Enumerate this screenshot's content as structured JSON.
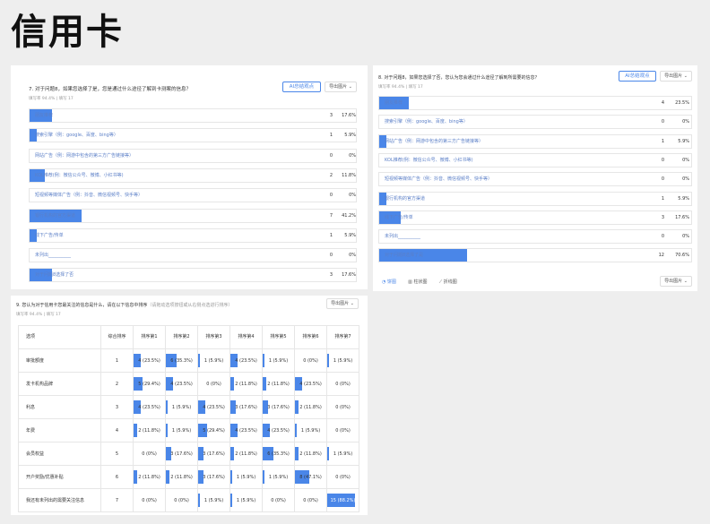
{
  "page_title": "信用卡",
  "q7": {
    "title": "7. 对于问题8，如果您选择了是，您是通过什么途径了解到卡测案的信息？",
    "meta": "填写率 94.4% | 填写 17",
    "ai_label": "AI总结观点",
    "export_label": "导出图片 ⌄",
    "rows": [
      {
        "label": "朋友推荐",
        "count": "3",
        "pct": "17.6%",
        "frac": 0.176
      },
      {
        "label": "搜索引擎（例：google、百度、bing等）",
        "count": "1",
        "pct": "5.9%",
        "frac": 0.059
      },
      {
        "label": "网站广告（例：网游中包含的第三方广告链接等）",
        "count": "0",
        "pct": "0%",
        "frac": 0
      },
      {
        "label": "KOL推荐(例：微信公众号、微博、小红书等)",
        "count": "2",
        "pct": "11.8%",
        "frac": 0.118
      },
      {
        "label": "短视频等媒体广告（例：抖音、微信视频号、快手等）",
        "count": "0",
        "pct": "0%",
        "frac": 0
      },
      {
        "label": "银行机构的官方渠道",
        "count": "7",
        "pct": "41.2%",
        "frac": 0.412
      },
      {
        "label": "线下广告/传单",
        "count": "1",
        "pct": "5.9%",
        "frac": 0.059
      },
      {
        "label": "未列出__________",
        "count": "0",
        "pct": "0%",
        "frac": 0
      },
      {
        "label": "对于问题8选择了否",
        "count": "3",
        "pct": "17.6%",
        "frac": 0.176
      }
    ]
  },
  "q8": {
    "title": "8. 对于问题8，如果您选择了否，您认为您会通过什么途径了解到所需要的信息？",
    "meta": "填写率 94.4% | 填写 17",
    "ai_label": "AI总结观点",
    "export_label": "导出图片 ⌄",
    "rows": [
      {
        "label": "朋友推荐",
        "count": "4",
        "pct": "23.5%",
        "frac": 0.235
      },
      {
        "label": "搜索引擎（例：google、百度、bing等）",
        "count": "0",
        "pct": "0%",
        "frac": 0
      },
      {
        "label": "网站广告（例：网游中包含的第三方广告链接等）",
        "count": "1",
        "pct": "5.9%",
        "frac": 0.059
      },
      {
        "label": "KOL推荐(例：微信公众号、微博、小红书等)",
        "count": "0",
        "pct": "0%",
        "frac": 0
      },
      {
        "label": "短视频等媒体广告（例：抖音、微信视频号、快手等）",
        "count": "0",
        "pct": "0%",
        "frac": 0
      },
      {
        "label": "银行机构的官方渠道",
        "count": "1",
        "pct": "5.9%",
        "frac": 0.059
      },
      {
        "label": "线下广告/传单",
        "count": "3",
        "pct": "17.6%",
        "frac": 0.176
      },
      {
        "label": "未列出__________",
        "count": "0",
        "pct": "0%",
        "frac": 0
      },
      {
        "label": "对于问题8选择了是",
        "count": "12",
        "pct": "70.6%",
        "frac": 0.706
      }
    ],
    "views": [
      "饼图",
      "柱状图",
      "折线图"
    ],
    "export_bottom_label": "导出图片 ⌄"
  },
  "q9": {
    "title": "9. 您认为对于信用卡您最关注的信息是什么，请在以下信息中排序",
    "subtitle": "（请拖动选项按钮或从右侧点选进行排序）",
    "meta": "填写率 94.4% | 填写 17",
    "export_label": "导出图片 ⌄",
    "headers": [
      "选项",
      "综合排序",
      "排序第1",
      "排序第2",
      "排序第3",
      "排序第4",
      "排序第5",
      "排序第6",
      "排序第7"
    ],
    "rows": [
      {
        "option": "审批额度",
        "rank": "1",
        "cells": [
          {
            "t": "4 (23.5%)",
            "f": 0.235
          },
          {
            "t": "6 (35.3%)",
            "f": 0.353
          },
          {
            "t": "1 (5.9%)",
            "f": 0.059
          },
          {
            "t": "4 (23.5%)",
            "f": 0.235
          },
          {
            "t": "1 (5.9%)",
            "f": 0.059
          },
          {
            "t": "0 (0%)",
            "f": 0
          },
          {
            "t": "1 (5.9%)",
            "f": 0.059
          }
        ]
      },
      {
        "option": "发卡机构品牌",
        "rank": "2",
        "cells": [
          {
            "t": "5 (29.4%)",
            "f": 0.294
          },
          {
            "t": "4 (23.5%)",
            "f": 0.235
          },
          {
            "t": "0 (0%)",
            "f": 0
          },
          {
            "t": "2 (11.8%)",
            "f": 0.118
          },
          {
            "t": "2 (11.8%)",
            "f": 0.118
          },
          {
            "t": "4 (23.5%)",
            "f": 0.235
          },
          {
            "t": "0 (0%)",
            "f": 0
          }
        ]
      },
      {
        "option": "利息",
        "rank": "3",
        "cells": [
          {
            "t": "4 (23.5%)",
            "f": 0.235
          },
          {
            "t": "1 (5.9%)",
            "f": 0.059
          },
          {
            "t": "4 (23.5%)",
            "f": 0.235
          },
          {
            "t": "3 (17.6%)",
            "f": 0.176
          },
          {
            "t": "3 (17.6%)",
            "f": 0.176
          },
          {
            "t": "2 (11.8%)",
            "f": 0.118
          },
          {
            "t": "0 (0%)",
            "f": 0
          }
        ]
      },
      {
        "option": "年费",
        "rank": "4",
        "cells": [
          {
            "t": "2 (11.8%)",
            "f": 0.118
          },
          {
            "t": "1 (5.9%)",
            "f": 0.059
          },
          {
            "t": "5 (29.4%)",
            "f": 0.294
          },
          {
            "t": "4 (23.5%)",
            "f": 0.235
          },
          {
            "t": "4 (23.5%)",
            "f": 0.235
          },
          {
            "t": "1 (5.9%)",
            "f": 0.059
          },
          {
            "t": "0 (0%)",
            "f": 0
          }
        ]
      },
      {
        "option": "会员权益",
        "rank": "5",
        "cells": [
          {
            "t": "0 (0%)",
            "f": 0
          },
          {
            "t": "3 (17.6%)",
            "f": 0.176
          },
          {
            "t": "3 (17.6%)",
            "f": 0.176
          },
          {
            "t": "2 (11.8%)",
            "f": 0.118
          },
          {
            "t": "6 (35.3%)",
            "f": 0.353
          },
          {
            "t": "2 (11.8%)",
            "f": 0.118
          },
          {
            "t": "1 (5.9%)",
            "f": 0.059
          }
        ]
      },
      {
        "option": "开户奖励/优惠补贴",
        "rank": "6",
        "cells": [
          {
            "t": "2 (11.8%)",
            "f": 0.118
          },
          {
            "t": "2 (11.8%)",
            "f": 0.118
          },
          {
            "t": "3 (17.6%)",
            "f": 0.176
          },
          {
            "t": "1 (5.9%)",
            "f": 0.059
          },
          {
            "t": "1 (5.9%)",
            "f": 0.059
          },
          {
            "t": "8 (47.1%)",
            "f": 0.471
          },
          {
            "t": "0 (0%)",
            "f": 0
          }
        ]
      },
      {
        "option": "我还有未列出的需要关注信息",
        "rank": "7",
        "cells": [
          {
            "t": "0 (0%)",
            "f": 0
          },
          {
            "t": "0 (0%)",
            "f": 0
          },
          {
            "t": "1 (5.9%)",
            "f": 0.059
          },
          {
            "t": "1 (5.9%)",
            "f": 0.059
          },
          {
            "t": "0 (0%)",
            "f": 0
          },
          {
            "t": "0 (0%)",
            "f": 0
          },
          {
            "t": "15 (88.2%)",
            "f": 0.882
          }
        ]
      }
    ]
  },
  "colors": {
    "accent": "#4a86e8"
  }
}
